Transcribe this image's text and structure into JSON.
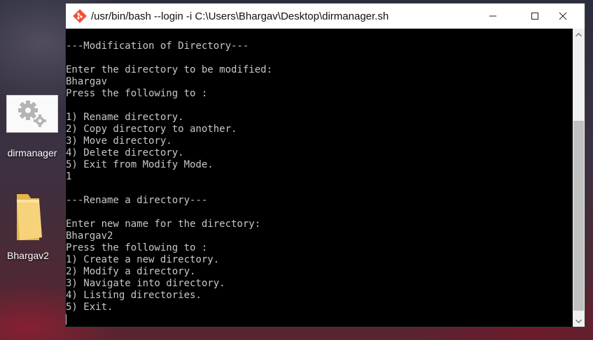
{
  "desktop": {
    "icons": [
      {
        "label": "dirmanager",
        "icon": "gears-icon"
      },
      {
        "label": "Bhargav2",
        "icon": "folder-icon"
      }
    ]
  },
  "window": {
    "title": "/usr/bin/bash --login -i C:\\Users\\Bhargav\\Desktop\\dirmanager.sh",
    "app_icon": "git-bash-icon",
    "controls": {
      "minimize": "minimize-icon",
      "maximize": "maximize-icon",
      "close": "close-icon"
    }
  },
  "console": {
    "lines": [
      "---Modification of Directory---",
      "",
      "Enter the directory to be modified:",
      "Bhargav",
      "Press the following to :",
      "",
      "1) Rename directory.",
      "2) Copy directory to another.",
      "3) Move directory.",
      "4) Delete directory.",
      "5) Exit from Modify Mode.",
      "1",
      "",
      "---Rename a directory---",
      "",
      "Enter new name for the directory:",
      "Bhargav2",
      "Press the following to :",
      "1) Create a new directory.",
      "2) Modify a directory.",
      "3) Navigate into directory.",
      "4) Listing directories.",
      "5) Exit.",
      ""
    ]
  },
  "colors": {
    "console_bg": "#000000",
    "console_fg": "#c8c8c8",
    "titlebar_bg": "#ffffff"
  }
}
